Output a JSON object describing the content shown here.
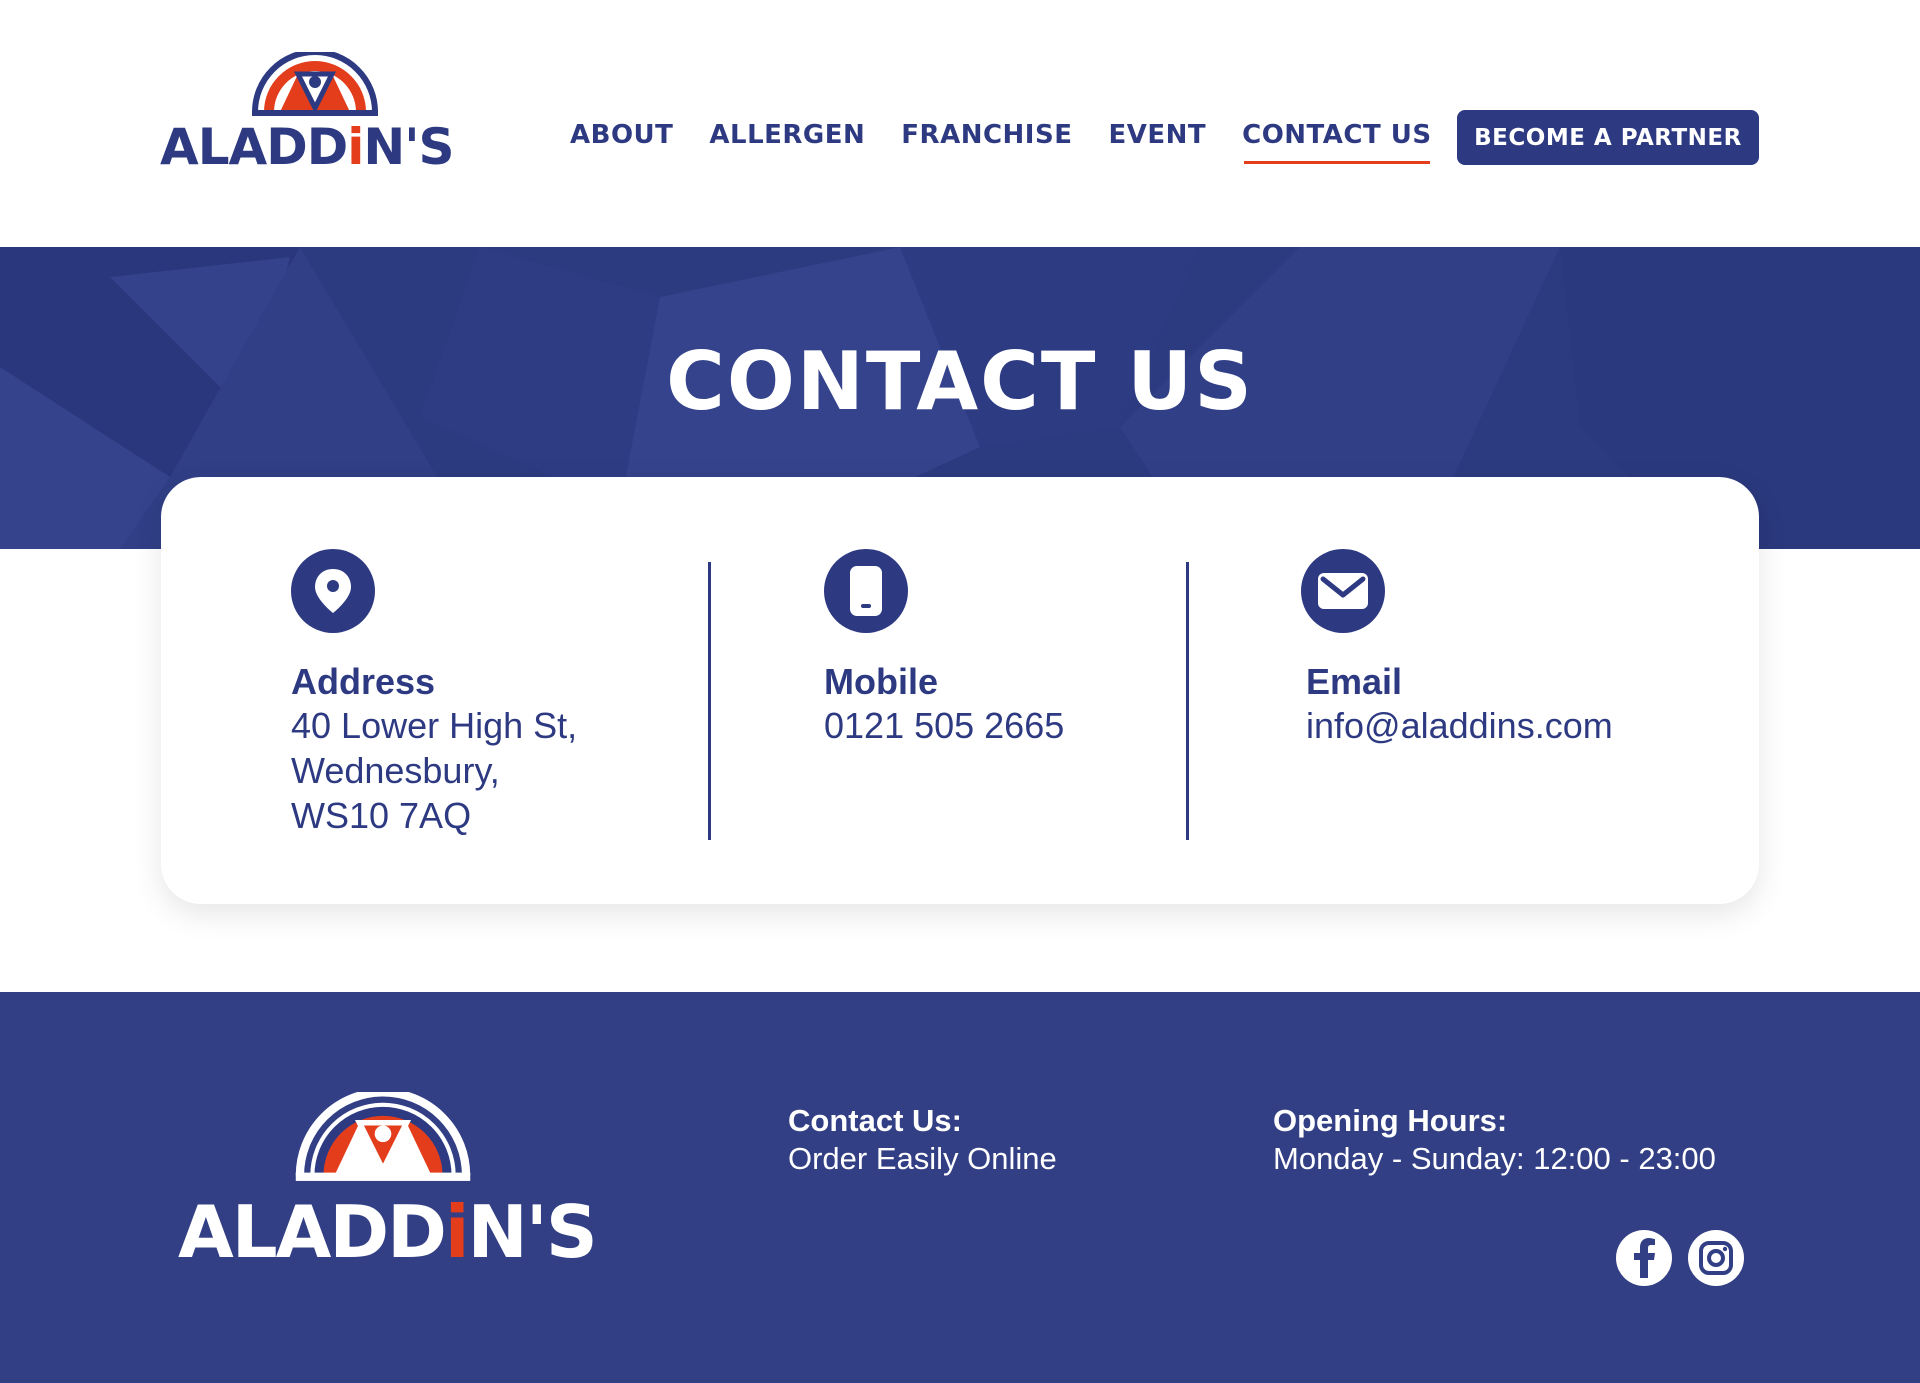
{
  "brand": {
    "name_prefix": "ALADD",
    "name_i": "i",
    "name_suffix": "N'S",
    "colors": {
      "navy": "#2d3a82",
      "red": "#e33d1c",
      "white": "#ffffff"
    }
  },
  "nav": {
    "items": [
      {
        "label": "ABOUT",
        "active": false
      },
      {
        "label": "ALLERGEN",
        "active": false
      },
      {
        "label": "FRANCHISE",
        "active": false
      },
      {
        "label": "EVENT",
        "active": false
      },
      {
        "label": "CONTACT US",
        "active": true
      }
    ],
    "cta_label": "BECOME A PARTNER"
  },
  "hero": {
    "title": "CONTACT US"
  },
  "contact": {
    "address": {
      "icon": "location-pin-icon",
      "label": "Address",
      "value": "40 Lower High St,\nWednesbury,\nWS10 7AQ"
    },
    "mobile": {
      "icon": "mobile-phone-icon",
      "label": "Mobile",
      "value": "0121 505 2665"
    },
    "email": {
      "icon": "envelope-icon",
      "label": "Email",
      "value": "info@aladdins.com"
    }
  },
  "footer": {
    "contact_heading": "Contact Us:",
    "contact_text": "Order Easily Online",
    "hours_heading": "Opening Hours:",
    "hours_text": "Monday - Sunday: 12:00 - 23:00",
    "social": [
      {
        "icon": "facebook-icon"
      },
      {
        "icon": "instagram-icon"
      }
    ]
  }
}
